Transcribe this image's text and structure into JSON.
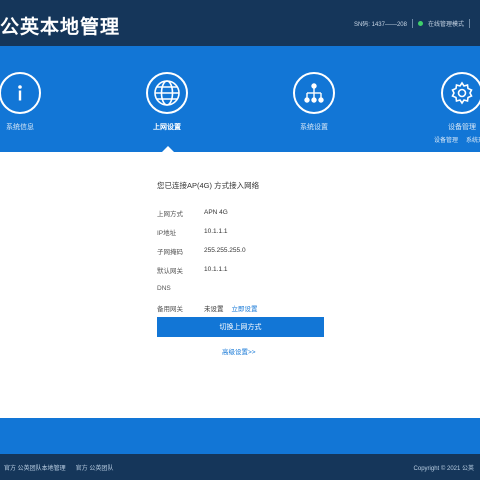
{
  "header": {
    "title": "公英本地管理",
    "device_info": "SN码: 1437——208",
    "status_text": "在线管理模式"
  },
  "nav": {
    "items": [
      {
        "label": "系统信息",
        "icon": "info-icon",
        "active": false,
        "sub": []
      },
      {
        "label": "上网设置",
        "icon": "globe-icon",
        "active": true,
        "sub": []
      },
      {
        "label": "系统设置",
        "icon": "network-icon",
        "active": false,
        "sub": []
      },
      {
        "label": "设备管理",
        "icon": "gear-icon",
        "active": false,
        "sub": [
          "设备管理",
          "系统升级"
        ]
      }
    ]
  },
  "panel": {
    "heading": "您已连接AP(4G) 方式接入网络",
    "rows": [
      {
        "key": "上网方式",
        "value": "APN 4G"
      },
      {
        "key": "IP地址",
        "value": "10.1.1.1"
      },
      {
        "key": "子网掩码",
        "value": "255.255.255.0"
      },
      {
        "key": "默认网关",
        "value": "10.1.1.1"
      },
      {
        "key": "DNS",
        "value": ""
      },
      {
        "key": "备用网关",
        "value": "未设置",
        "link": "立即设置"
      }
    ],
    "primary_button": "切换上网方式",
    "more_link": "高级设置>>"
  },
  "footer": {
    "left_links": [
      "官方 公英团队本地管理",
      "官方 公英团队"
    ],
    "copyright": "Copyright © 2021 公英"
  },
  "colors": {
    "header_bg": "#15365a",
    "accent_blue": "#1276d6",
    "panel_bg": "#ffffff"
  }
}
